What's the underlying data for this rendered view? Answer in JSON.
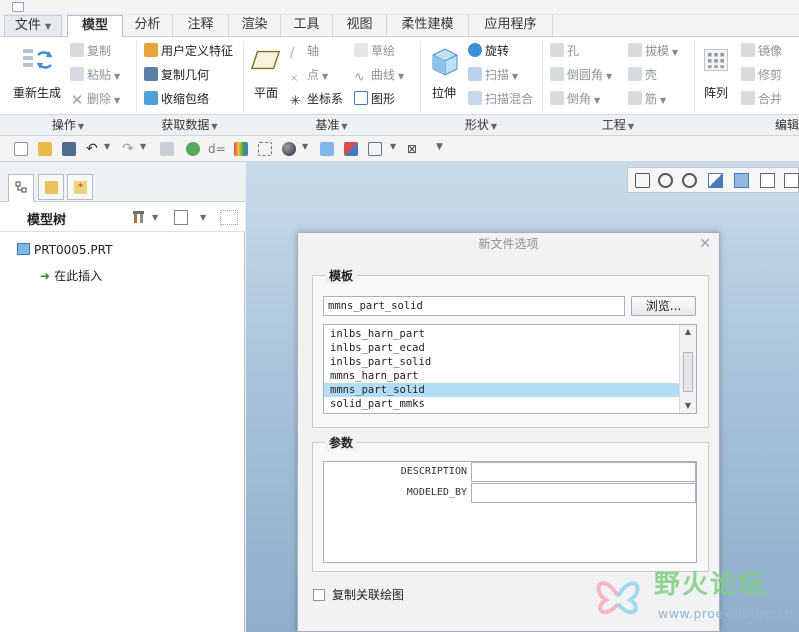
{
  "menu": {
    "tabs": [
      "文件",
      "模型",
      "分析",
      "注释",
      "渲染",
      "工具",
      "视图",
      "柔性建模",
      "应用程序"
    ]
  },
  "ribbon": {
    "operations": {
      "regenerate": "重新生成",
      "copy": "复制",
      "paste": "粘贴",
      "delete": "删除",
      "group": "操作"
    },
    "get_data": {
      "udf": "用户定义特征",
      "copy_geometry": "复制几何",
      "shrinkwrap": "收缩包络",
      "group": "获取数据"
    },
    "datum": {
      "plane": "平面",
      "axis": "轴",
      "point": "点",
      "coordinate_system": "坐标系",
      "sketch": "草绘",
      "curve": "曲线",
      "graph": "图形",
      "group": "基准"
    },
    "shapes": {
      "extrude": "拉伸",
      "revolve": "旋转",
      "sweep": "扫描",
      "swept_blend": "扫描混合",
      "group": "形状"
    },
    "engineering": {
      "hole": "孔",
      "round": "倒圆角",
      "chamfer": "倒角",
      "draft": "拔模",
      "shell": "壳",
      "rib": "筋",
      "group": "工程"
    },
    "editing": {
      "pattern": "阵列",
      "mirror": "镜像",
      "trim": "修剪",
      "merge": "合并",
      "group": "编辑"
    }
  },
  "left_panel": {
    "title": "模型树",
    "items": [
      {
        "label": "PRT0005.PRT"
      },
      {
        "label": "在此插入"
      }
    ]
  },
  "dialog": {
    "title": "新文件选项",
    "template_section": "模板",
    "template_value": "mmns_part_solid",
    "browse_label": "浏览...",
    "templates": [
      {
        "name": "inlbs_harn_part",
        "selected": false
      },
      {
        "name": "inlbs_part_ecad",
        "selected": false
      },
      {
        "name": "inlbs_part_solid",
        "selected": false
      },
      {
        "name": "mmns_harn_part",
        "selected": false
      },
      {
        "name": "mmns_part_solid",
        "selected": true
      },
      {
        "name": "solid_part_mmks",
        "selected": false
      }
    ],
    "params_section": "参数",
    "params": [
      {
        "name": "DESCRIPTION",
        "value": ""
      },
      {
        "name": "MODELED_BY",
        "value": ""
      }
    ],
    "copy_drawing_label": "复制关联绘图",
    "copy_drawing_checked": false
  },
  "watermark": {
    "text": "野火论坛",
    "url": "www.proewildfire.cn"
  }
}
